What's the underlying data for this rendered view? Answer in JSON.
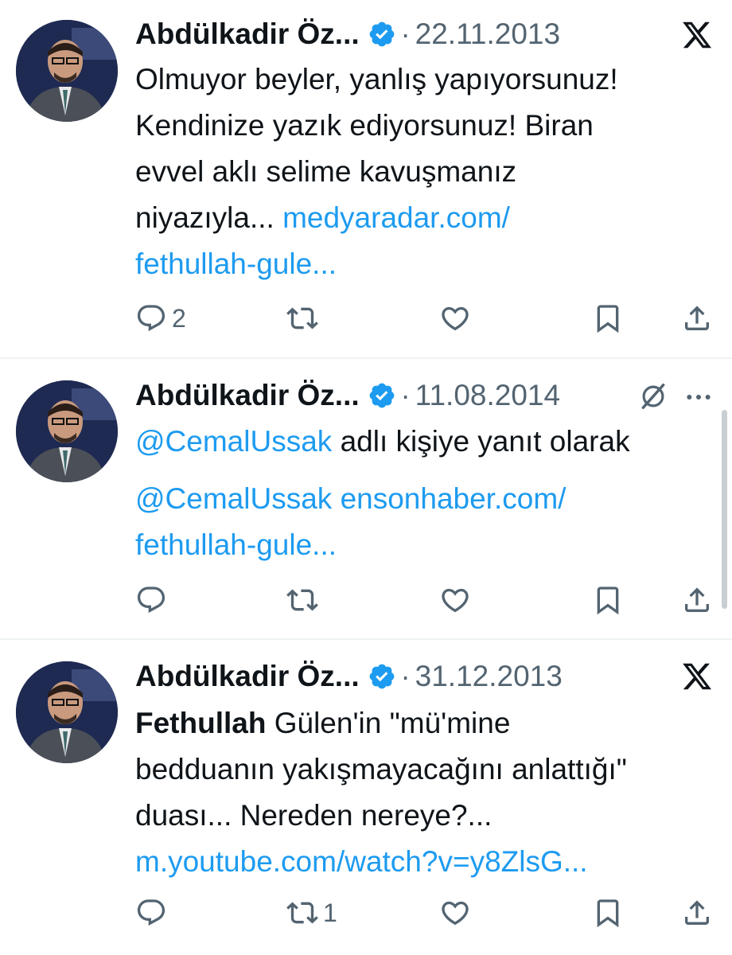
{
  "tweets": [
    {
      "author": "Abdülkadir Öz...",
      "date": "22.11.2013",
      "corner_icon": "x-logo-icon",
      "text": "Olmuyor beyler, yanlış yapıyorsunuz! Kendinize yazık ediyorsunuz! Biran evvel aklı selime kavuşmanız niyazıyla...",
      "link": "medyaradar.com/ fethullah-gule...",
      "lines": [
        "Olmuyor beyler, yanlış yapıyorsunuz!",
        "Kendinize yazık ediyorsunuz! Biran",
        "evvel aklı selime kavuşmanız"
      ],
      "line4_text": "niyazıyla...",
      "line4_link": "medyaradar.com/",
      "line5_link": "fethullah-gule...",
      "reply_count": "2",
      "retweet_count": "",
      "like_count": ""
    },
    {
      "author": "Abdülkadir Öz...",
      "date": "11.08.2014",
      "corner_icon": "grok-icon",
      "more_icon": "more-icon",
      "reply_to_handle": "@CemalUssak",
      "reply_to_suffix": "adlı kişiye yanıt olarak",
      "mention": "@CemalUssak",
      "link_line1": "ensonhaber.com/",
      "link_line2": "fethullah-gule...",
      "reply_count": "",
      "retweet_count": "",
      "like_count": ""
    },
    {
      "author": "Abdülkadir Öz...",
      "date": "31.12.2013",
      "corner_icon": "x-logo-icon",
      "bold_word": "Fethullah",
      "line1_rest": "Gülen'in \"mü'mine",
      "line2": "bedduanın yakışmayacağını anlattığı\"",
      "line3": "duası... Nereden nereye?...",
      "link": "m.youtube.com/watch?v=y8ZlsG...",
      "reply_count": "",
      "retweet_count": "1",
      "like_count": ""
    }
  ],
  "colors": {
    "link": "#1d9bf0",
    "muted": "#536471",
    "text": "#0f1419",
    "verified": "#1d9bf0"
  }
}
